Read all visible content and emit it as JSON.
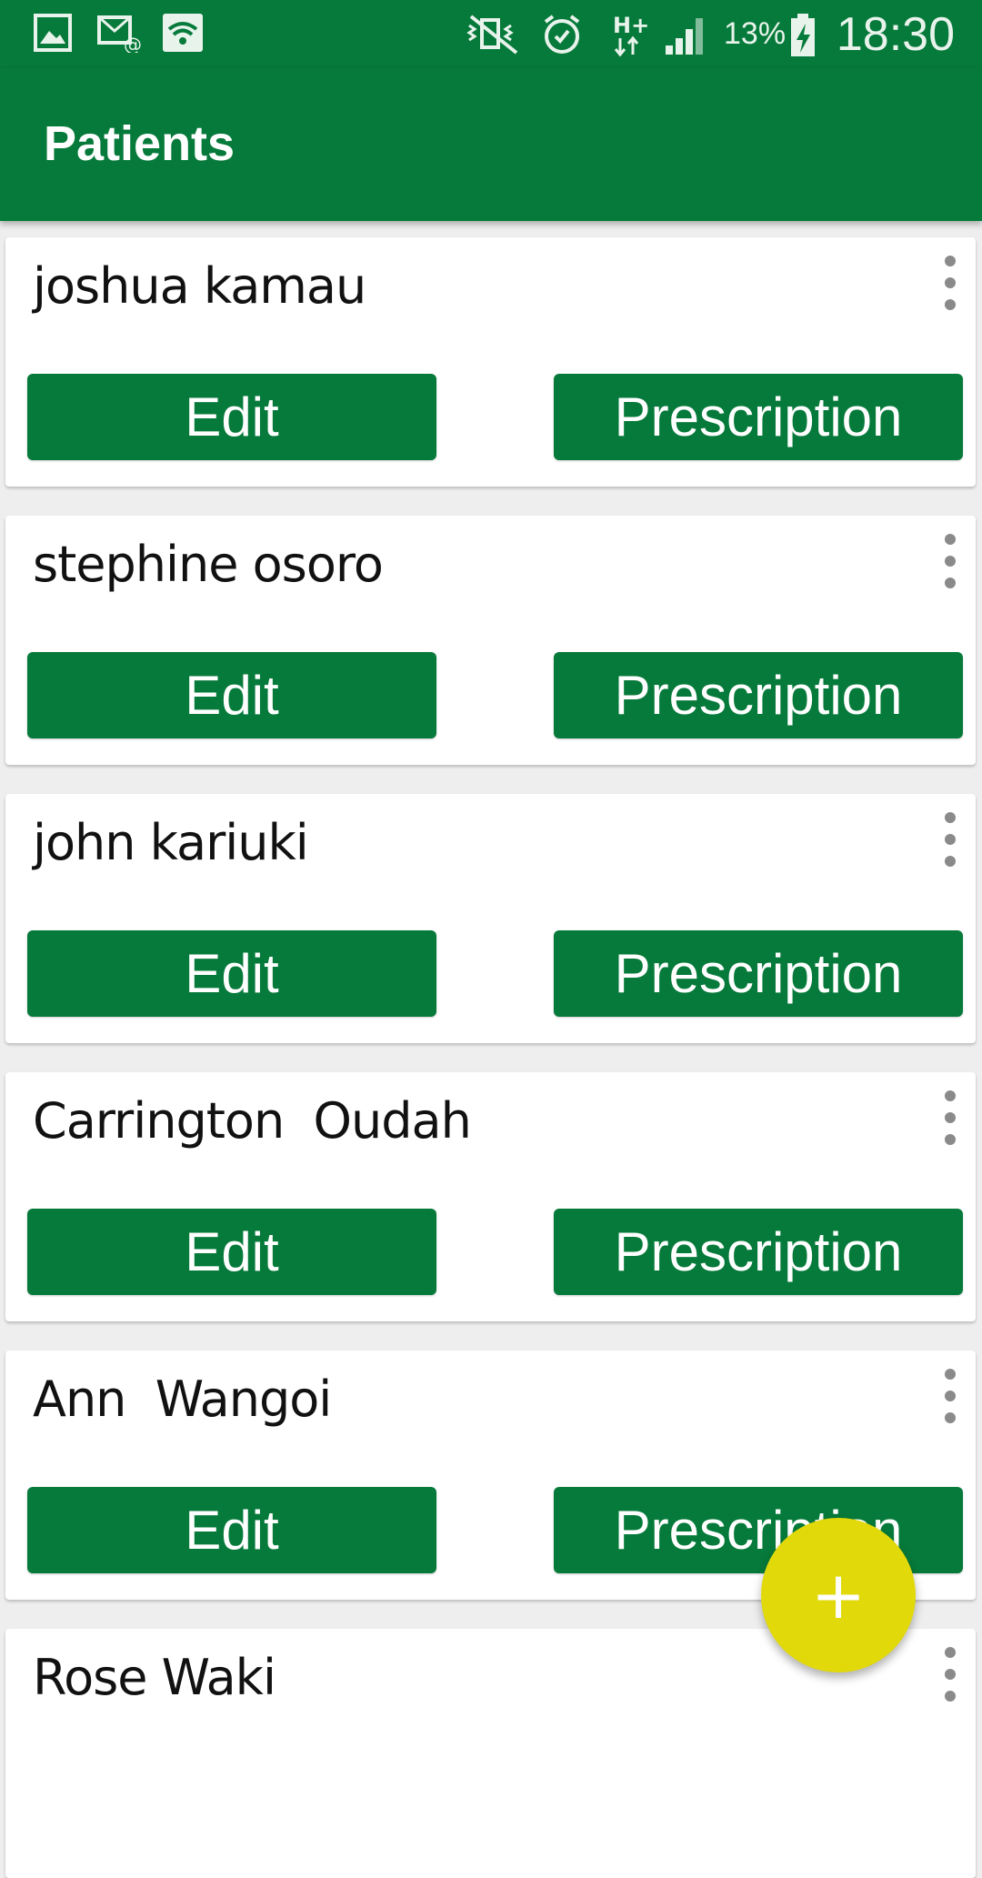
{
  "status_bar": {
    "icons": [
      "gallery-icon",
      "email-notification-icon",
      "wifi-icon",
      "mute-icon",
      "alarm-icon",
      "data-hplus-icon",
      "signal-icon",
      "battery-charging-icon"
    ],
    "battery_percent": "13%",
    "time": "18:30"
  },
  "app_bar": {
    "title": "Patients"
  },
  "buttons": {
    "edit_label": "Edit",
    "prescription_label": "Prescription"
  },
  "patients": [
    {
      "name": "joshua kamau"
    },
    {
      "name": "stephine osoro"
    },
    {
      "name": "john kariuki"
    },
    {
      "name": "Carrington  Oudah"
    },
    {
      "name": "Ann  Wangoi"
    },
    {
      "name": "Rose Waki"
    }
  ],
  "fab": {
    "label": "+"
  },
  "colors": {
    "primary": "#067a3a",
    "fab": "#e1d90a",
    "background": "#eeeeee"
  }
}
